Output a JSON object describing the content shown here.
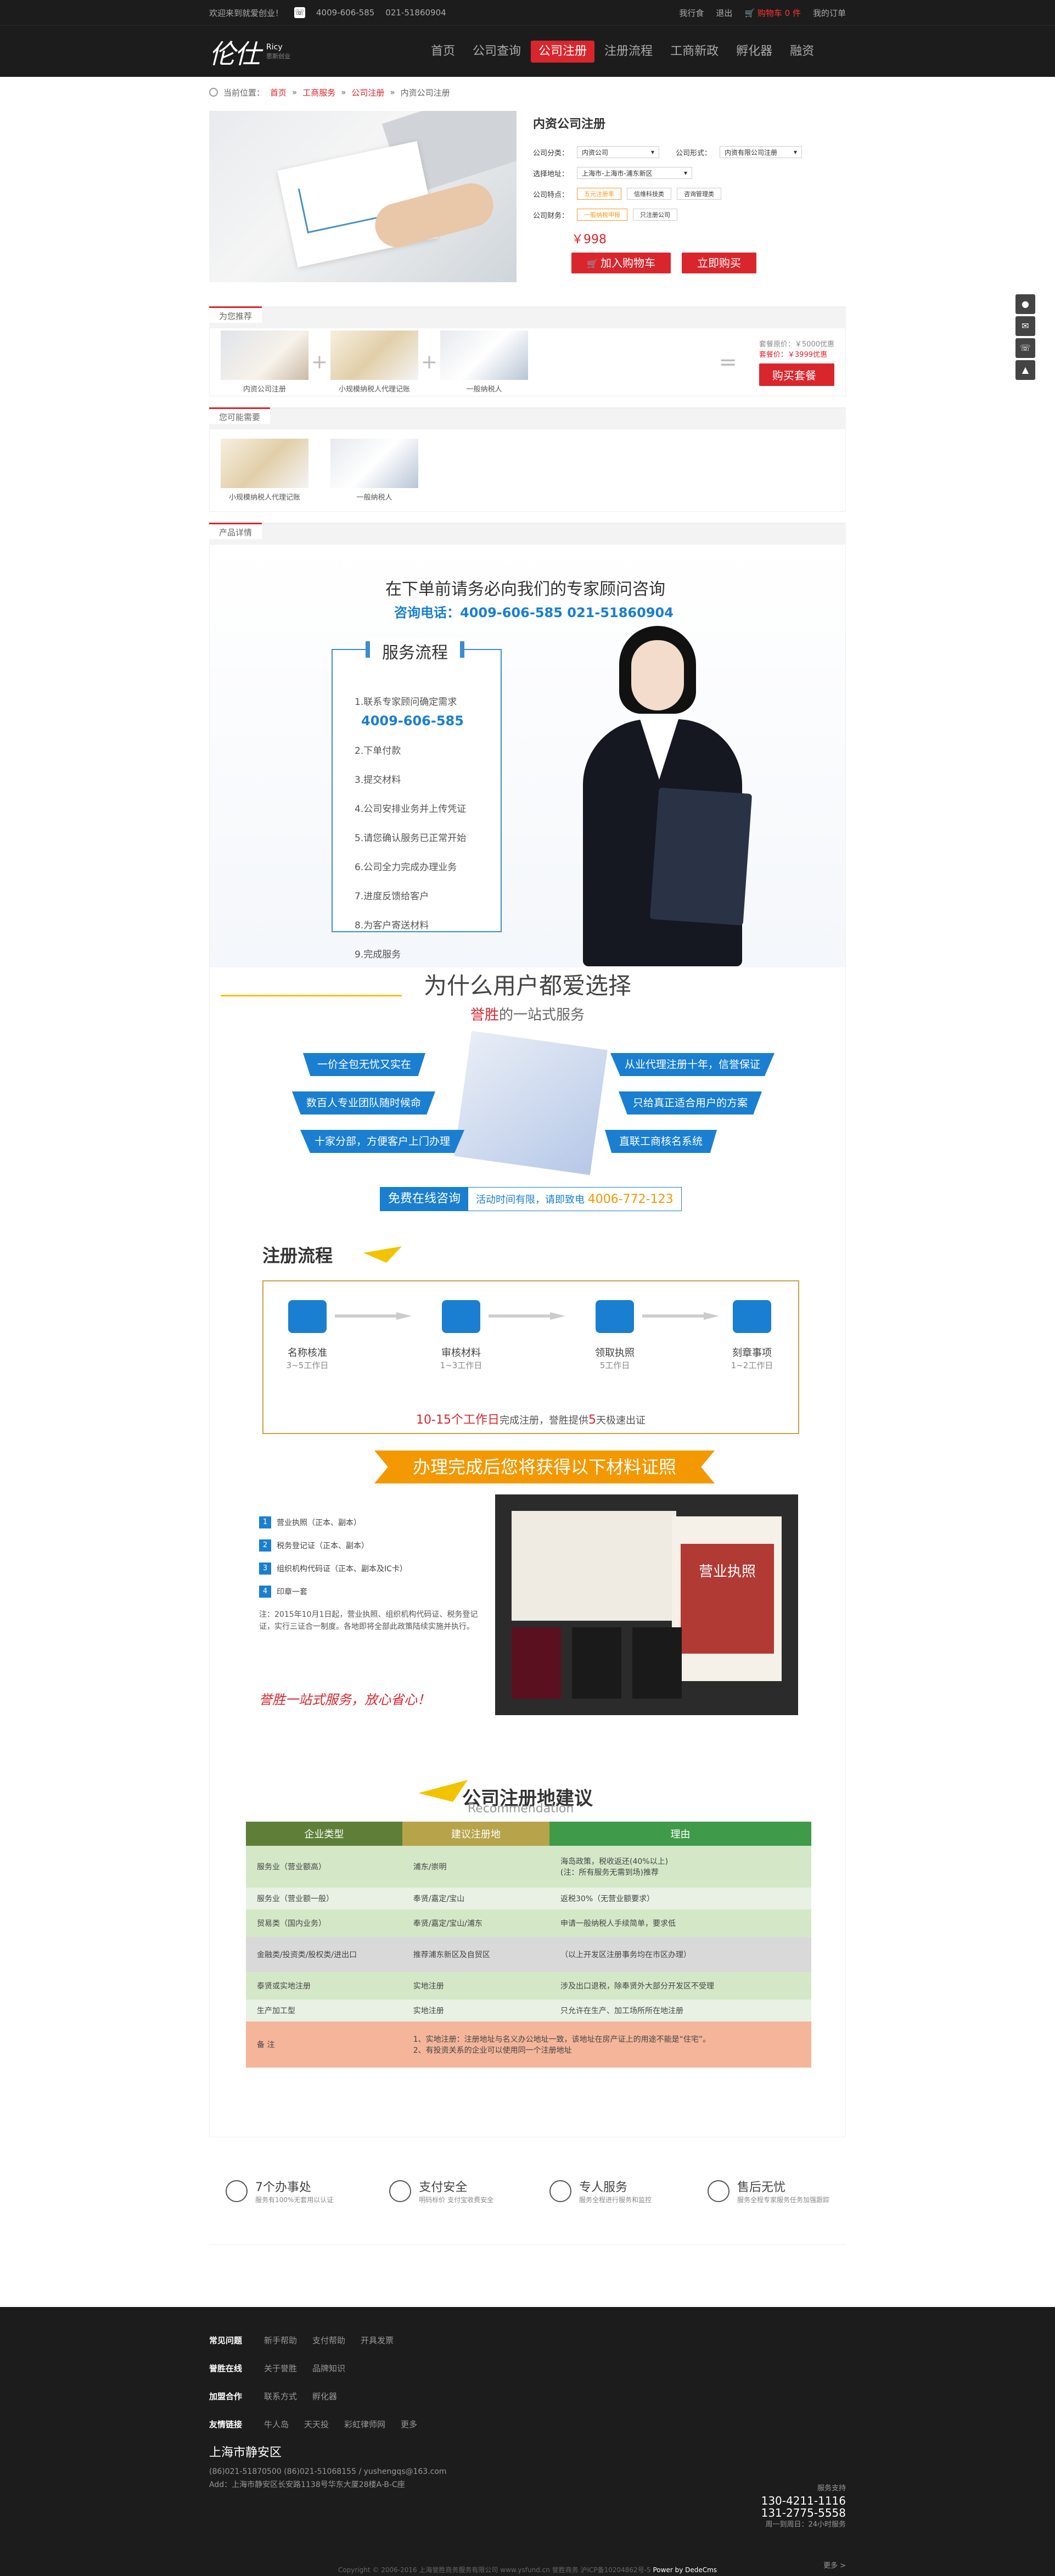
{
  "topbar": {
    "welcome": "欢迎来到就爱创业！",
    "phone1": "4009-606-585",
    "phone2": "021-51860904",
    "links": [
      "我行食",
      "退出"
    ],
    "cart": "购物车 0 件",
    "orders": "我的订单"
  },
  "header": {
    "logo_mark": "伦仕",
    "logo_en": "Ricy",
    "logo_sub": "思斯创业",
    "nav": [
      "首页",
      "公司查询",
      "公司注册",
      "注册流程",
      "工商新政",
      "孵化器",
      "融资"
    ]
  },
  "breadcrumb": {
    "label": "当前位置：",
    "path": [
      "首页",
      "工商服务",
      "公司注册"
    ],
    "current": "内资公司注册"
  },
  "product": {
    "title": "内资公司注册",
    "type_label": "公司分类：",
    "type_value": "内资公司",
    "form_label": "公司形式：",
    "form_value": "内资有限公司注册",
    "addr_label": "选择地址：",
    "addr_value": "上海市-上海市-浦东新区",
    "feature_label": "公司特点：",
    "features": [
      "五元注册率",
      "信维科技类",
      "咨询管理类"
    ],
    "finance_label": "公司财务：",
    "finance": [
      "一般纳税申报",
      "只注册公司"
    ],
    "price": "￥998",
    "add_cart": "加入购物车",
    "buy_now": "立即购买"
  },
  "recommend": {
    "title": "为您推荐",
    "items": [
      "内资公司注册",
      "小规模纳税人代理记账",
      "一般纳税人"
    ],
    "orig_price": "套餐原价：￥5000优惠",
    "cur_price": "套餐价：￥3999优惠",
    "buy": "购买套餐"
  },
  "maybe": {
    "title": "您可能需要",
    "items": [
      "小规模纳税人代理记账",
      "一般纳税人"
    ]
  },
  "detail_tab": "产品详情",
  "consult": {
    "title": "在下单前请务必向我们的专家顾问咨询",
    "tel": "咨询电话：4009-606-585   021-51860904",
    "box_title": "服务流程",
    "steps": [
      "1.联系专家顾问确定需求",
      "2.下单付款",
      "3.提交材料",
      "4.公司安排业务并上传凭证",
      "5.请您确认服务已正常开始",
      "6.公司全力完成办理业务",
      "7.进度反馈给客户",
      "8.为客户寄送材料",
      "9.完成服务"
    ],
    "box_tel": "4009-606-585"
  },
  "why": {
    "title": "为什么用户都爱选择",
    "sub_brand": "誉胜",
    "sub": "的一站式服务",
    "left": [
      "一价全包无忧又实在",
      "数百人专业团队随时候命",
      "十家分部，方便客户上门办理"
    ],
    "right": [
      "从业代理注册十年，信誉保证",
      "只给真正适合用户的方案",
      "直联工商核名系统"
    ],
    "free": "免费在线咨询",
    "free_note": "活动时间有限，请即致电",
    "free_tel": "4006-772-123"
  },
  "reg_flow": {
    "title": "注册流程",
    "steps": [
      {
        "name": "名称核准",
        "days": "3~5工作日"
      },
      {
        "name": "审核材料",
        "days": "1~3工作日"
      },
      {
        "name": "领取执照",
        "days": "5工作日"
      },
      {
        "name": "刻章事项",
        "days": "1~2工作日"
      }
    ],
    "note_days": "10-15个工作日",
    "note_mid": "完成注册，誉胜提供",
    "note_five": "5",
    "note_end": "天极速出证"
  },
  "certs": {
    "banner": "办理完成后您将获得以下材料证照",
    "items": [
      "营业执照（正本、副本）",
      "税务登记证（正本、副本）",
      "组织机构代码证（正本、副本及IC卡）",
      "印章一套"
    ],
    "note": "注：2015年10月1日起，营业执照、组织机构代码证、税务登记证，实行三证合一制度。各地即将全部此政策陆续实施并执行。",
    "slogan": "誉胜一站式服务，放心省心！",
    "lic_text": "营业执照"
  },
  "recom": {
    "title": "公司注册地建议",
    "en": "Recommendation",
    "headers": [
      "企业类型",
      "建议注册地",
      "理由"
    ],
    "rows": [
      [
        "服务业（营业额高）",
        "浦东/崇明",
        "海岛政策，税收返还(40%以上)\n(注：所有服务无需到场)推荐"
      ],
      [
        "服务业（营业额一般）",
        "奉贤/嘉定/宝山",
        "返税30%（无营业额要求）"
      ],
      [
        "贸易类（国内业务）",
        "奉贤/嘉定/宝山/浦东",
        "申请一般纳税人手续简单，要求低"
      ],
      [
        "金融类/投资类/股权类/进出口",
        "推荐浦东新区及自贸区",
        "（以上开发区注册事务均在市区办理）"
      ],
      [
        "泰贤或实地注册",
        "实地注册",
        "涉及出口退税，除奉贤外大部分开发区不受理"
      ],
      [
        "生产加工型",
        "实地注册",
        "只允许在生产、加工场所所在地注册"
      ]
    ],
    "note_head": "备  注",
    "note_lines": [
      "1、实地注册：注册地址与名义办公地址一致，该地址在房产证上的用途不能是“住宅”。",
      "2、有投资关系的企业可以使用同一个注册地址"
    ]
  },
  "promises": [
    {
      "title": "7个办事处",
      "desc": "服务有100%无套用以认证"
    },
    {
      "title": "支付安全",
      "desc": "明码标价 支付宝收费安全"
    },
    {
      "title": "专人服务",
      "desc": "服务全程进行服务和监控"
    },
    {
      "title": "售后无忧",
      "desc": "服务全程专家服务任务加强跟踪"
    }
  ],
  "footer": {
    "rows": [
      {
        "head": "常见问题",
        "links": [
          "新手帮助",
          "支付帮助",
          "开具发票"
        ]
      },
      {
        "head": "誉胜在线",
        "links": [
          "关于誉胜",
          "品牌知识"
        ]
      },
      {
        "head": "加盟合作",
        "links": [
          "联系方式",
          "孵化器"
        ]
      },
      {
        "head": "友情链接",
        "links": [
          "牛人岛",
          "天天投",
          "彩虹律师网",
          "更多"
        ]
      }
    ],
    "city": "上海市静安区",
    "phone_line": "(86)021-51870500      (86)021-51068155 / yushengqs@163.com",
    "addr": "Add：上海市静安区长安路1138号华东大厦28楼A-B-C座",
    "support_label": "服务支持",
    "tel1": "130-4211-1116",
    "tel2": "131-2775-5558",
    "hours": "周一到周日：24小时服务",
    "copyright": "Copyright © 2006-2016 上海誉胜商务服务有限公司 www.ysfund.cn 誉胜商务  沪ICP备10204862号-5",
    "powered": "Power by DedeCms",
    "more": "更多 >"
  },
  "side": [
    "qq-icon",
    "wechat-icon",
    "phone-icon",
    "top-icon"
  ]
}
